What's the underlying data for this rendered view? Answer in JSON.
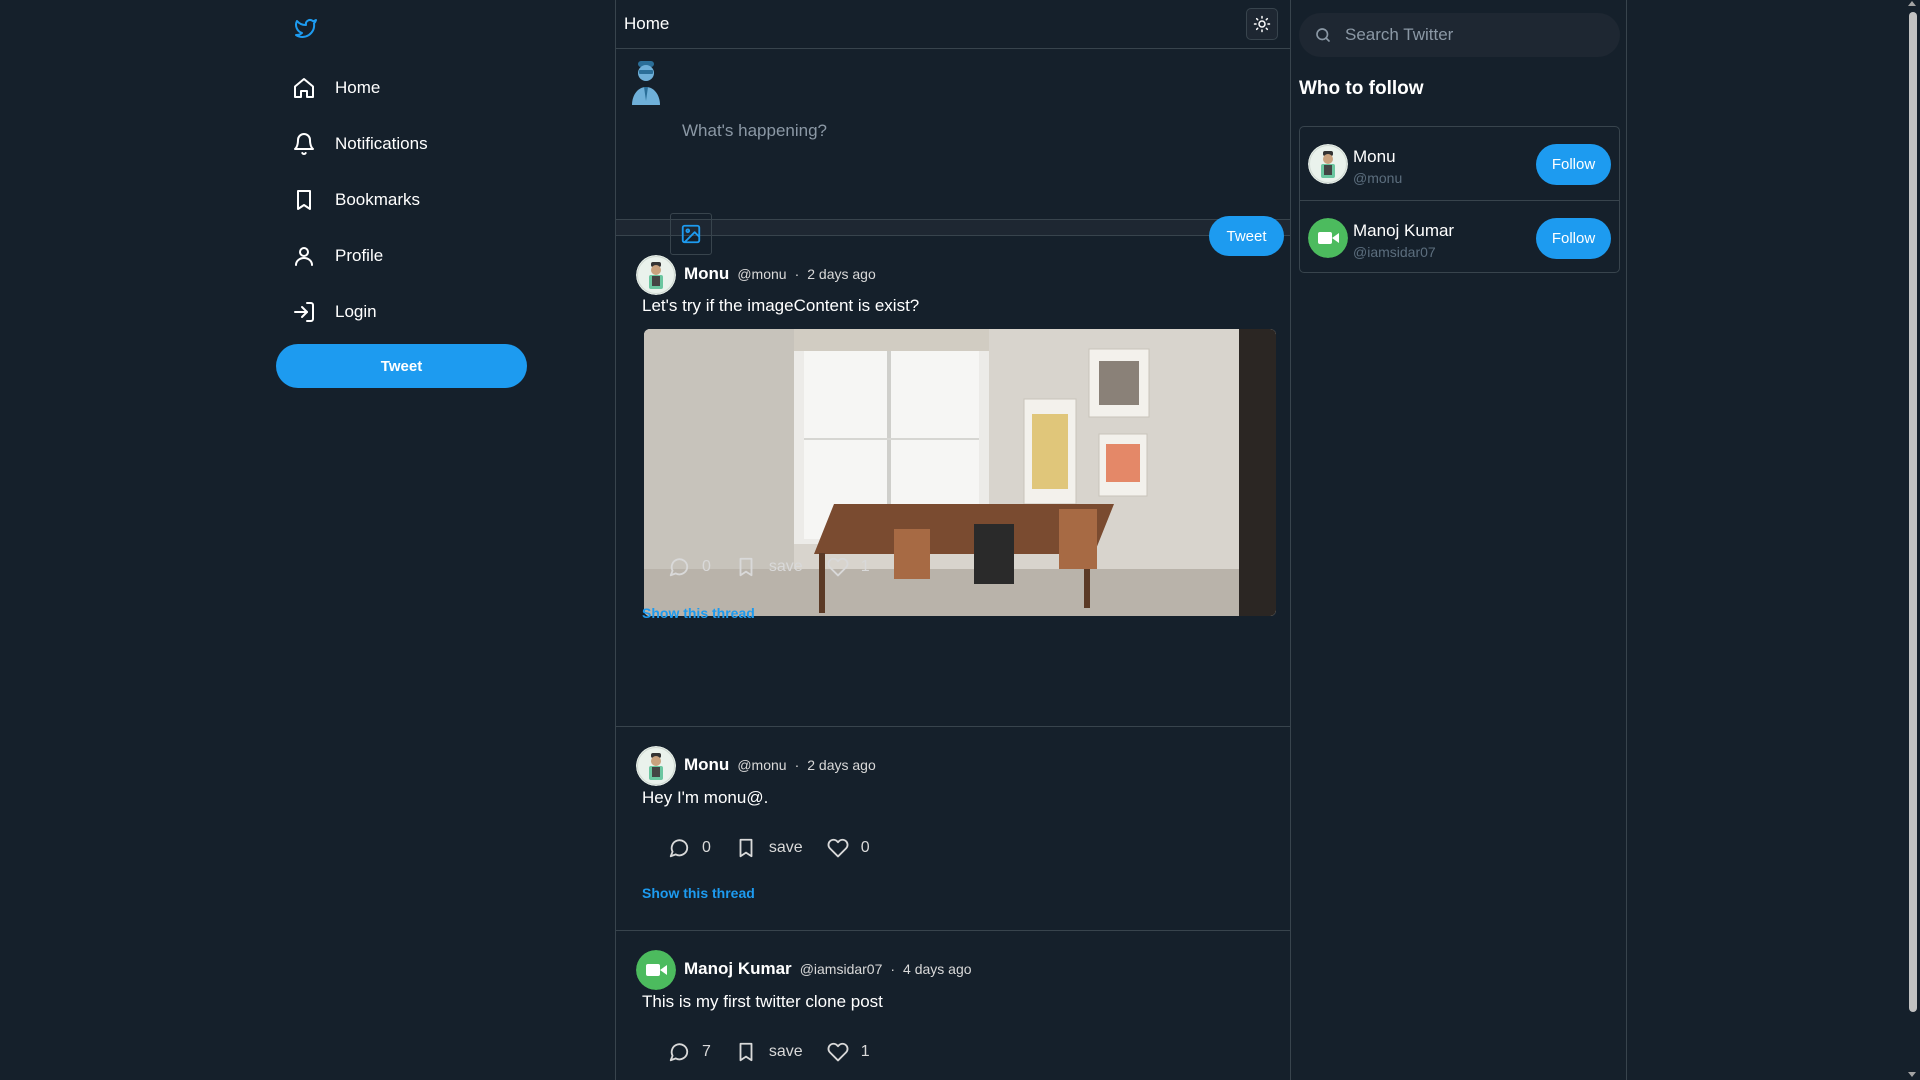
{
  "colors": {
    "background": "#15202b",
    "accent": "#1d9bf0",
    "border": "#38444d",
    "muted_text": "#8b98a5"
  },
  "sidebar": {
    "logo_icon": "twitter-bird-icon",
    "items": [
      {
        "label": "Home",
        "icon": "home-icon"
      },
      {
        "label": "Notifications",
        "icon": "bell-icon"
      },
      {
        "label": "Bookmarks",
        "icon": "bookmark-icon"
      },
      {
        "label": "Profile",
        "icon": "user-icon"
      },
      {
        "label": "Login",
        "icon": "login-icon"
      }
    ],
    "tweet_button": "Tweet"
  },
  "main": {
    "title": "Home",
    "theme_toggle_icon": "sun-icon",
    "composer": {
      "placeholder": "What's happening?",
      "image_icon": "image-icon",
      "tweet_button": "Tweet"
    },
    "tweets": [
      {
        "name": "Monu",
        "handle": "@monu",
        "time": "2 days ago",
        "text": "Let's try if the imageContent is exist?",
        "comments": "0",
        "save_label": "save",
        "likes": "1",
        "show_thread": "Show this thread"
      },
      {
        "name": "Monu",
        "handle": "@monu",
        "time": "2 days ago",
        "text": "Hey I'm monu@.",
        "comments": "0",
        "save_label": "save",
        "likes": "0",
        "show_thread": "Show this thread"
      },
      {
        "name": "Manoj Kumar",
        "handle": "@iamsidar07",
        "time": "4 days ago",
        "text": "This is my first twitter clone post",
        "comments": "7",
        "save_label": "save",
        "likes": "1"
      }
    ]
  },
  "right": {
    "search_placeholder": "Search Twitter",
    "who_to_follow_title": "Who to follow",
    "suggestions": [
      {
        "name": "Monu",
        "handle": "@monu",
        "button": "Follow"
      },
      {
        "name": "Manoj Kumar",
        "handle": "@iamsidar07",
        "button": "Follow"
      }
    ]
  }
}
